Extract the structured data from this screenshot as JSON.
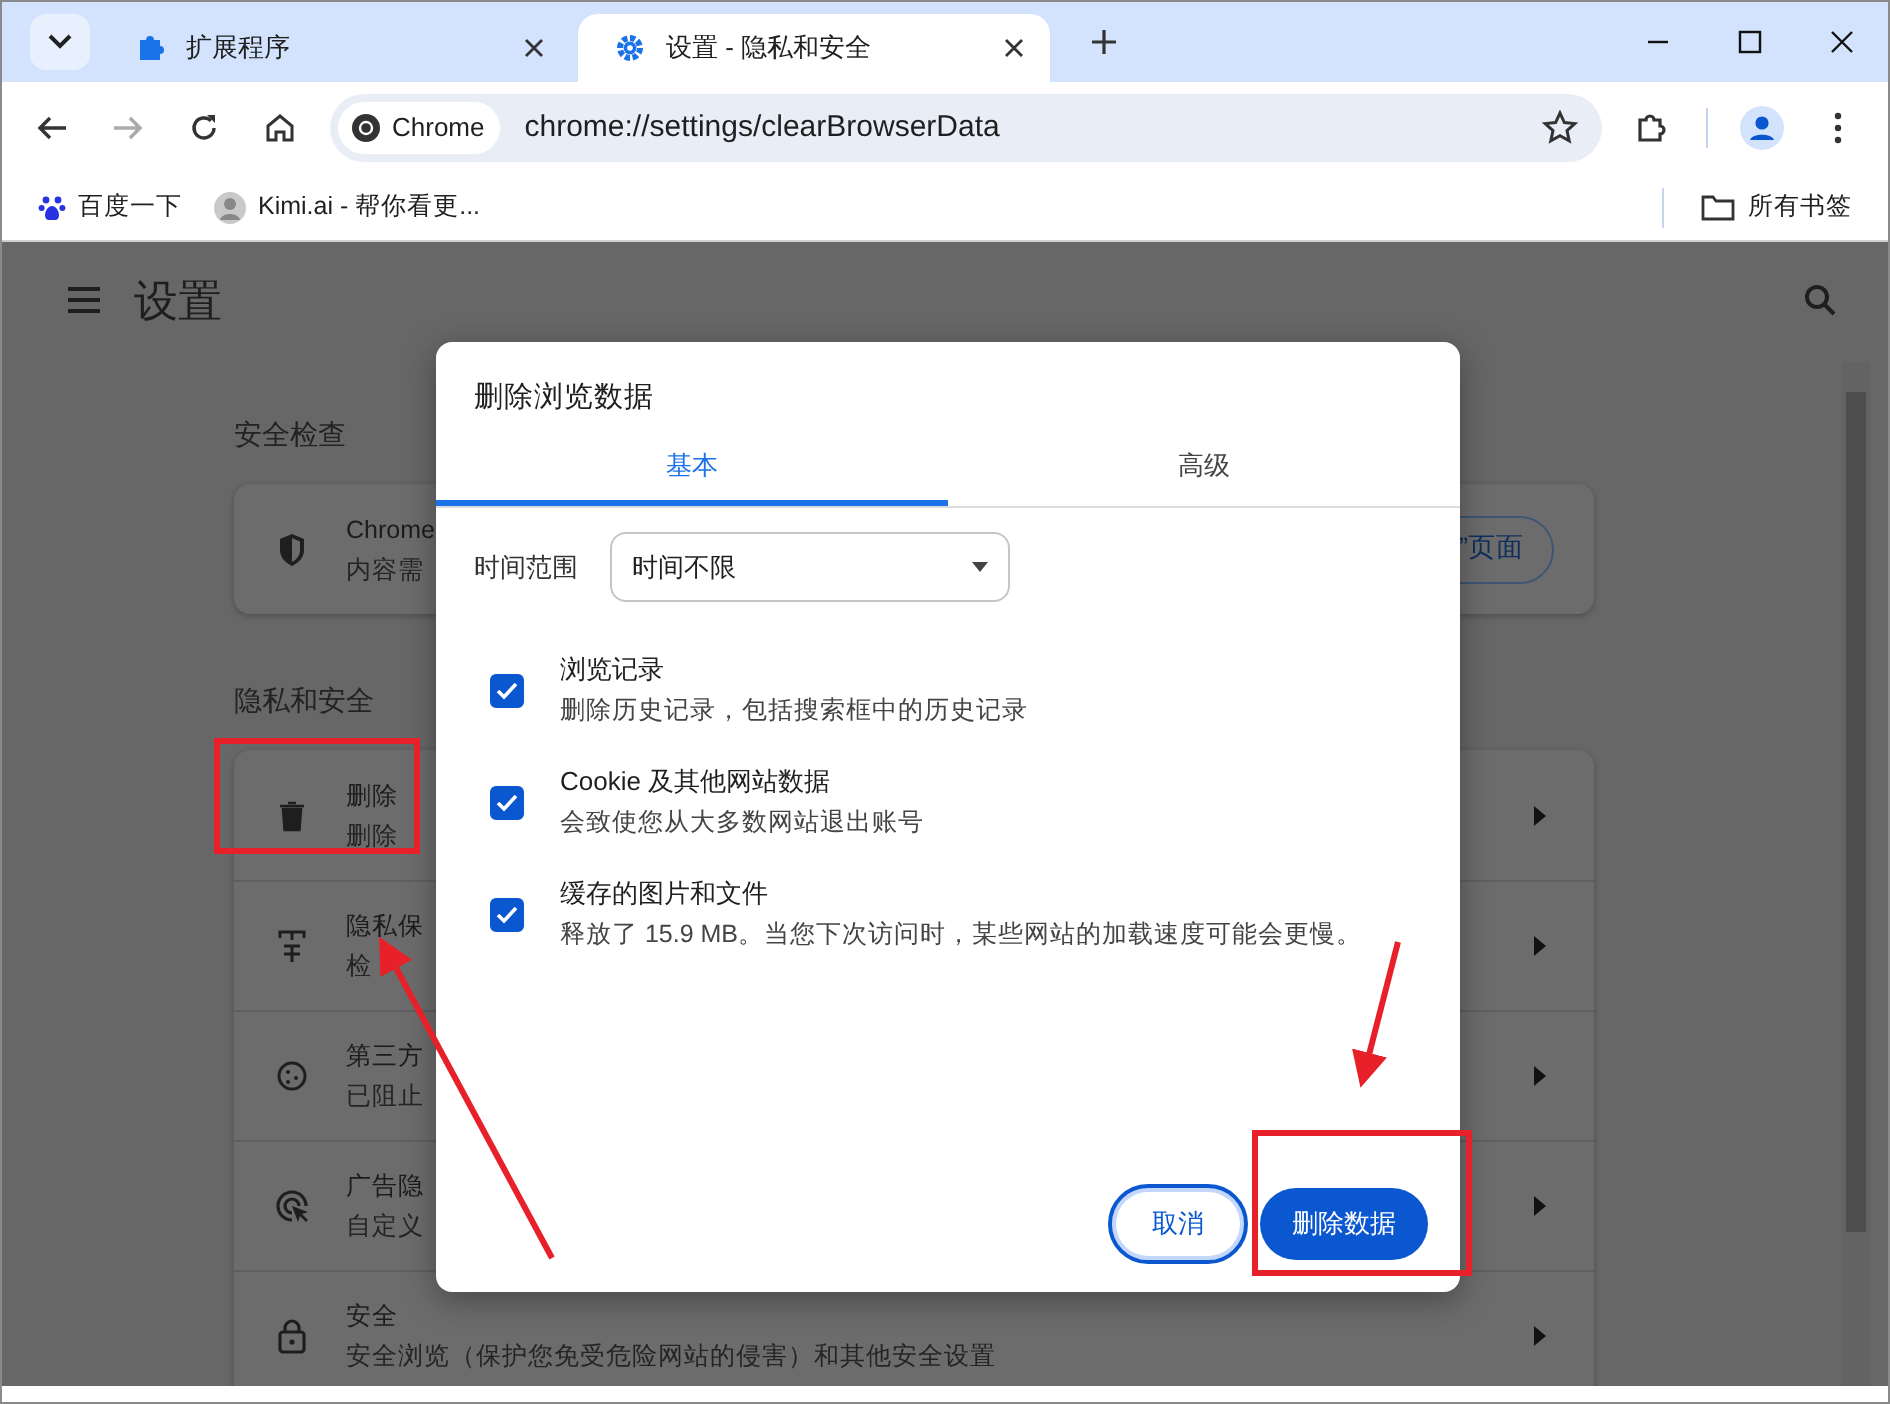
{
  "browser": {
    "tabs": [
      {
        "title": "扩展程序",
        "selected": false
      },
      {
        "title": "设置 - 隐私和安全",
        "selected": true
      }
    ],
    "address_bar": {
      "chip": "Chrome",
      "url": "chrome://settings/clearBrowserData"
    },
    "bookmarks": [
      {
        "label": "百度一下"
      },
      {
        "label": "Kimi.ai - 帮你看更..."
      }
    ],
    "all_bookmarks": "所有书签"
  },
  "settings": {
    "title": "设置",
    "safety_check": {
      "heading": "安全检查",
      "title": "Chrome",
      "subtitle": "内容需",
      "button": "”页面"
    },
    "privacy": {
      "heading": "隐私和安全",
      "rows": [
        {
          "title": "删除",
          "subtitle": "删除"
        },
        {
          "title": "隐私保",
          "subtitle": "检"
        },
        {
          "title": "第三方",
          "subtitle": "已阻止"
        },
        {
          "title": "广告隐",
          "subtitle": "自定义"
        },
        {
          "title": "安全",
          "subtitle": "安全浏览（保护您免受危险网站的侵害）和其他安全设置"
        }
      ]
    }
  },
  "dialog": {
    "title": "删除浏览数据",
    "tabs": [
      {
        "label": "基本",
        "selected": true
      },
      {
        "label": "高级",
        "selected": false
      }
    ],
    "time_range": {
      "label": "时间范围",
      "value": "时间不限"
    },
    "items": [
      {
        "title": "浏览记录",
        "subtitle": "删除历史记录，包括搜索框中的历史记录",
        "checked": true
      },
      {
        "title": "Cookie 及其他网站数据",
        "subtitle": "会致使您从大多数网站退出账号",
        "checked": true
      },
      {
        "title": "缓存的图片和文件",
        "subtitle": "释放了 15.9 MB。当您下次访问时，某些网站的加载速度可能会更慢。",
        "checked": true
      }
    ],
    "cancel_button": "取消",
    "confirm_button": "删除数据"
  }
}
